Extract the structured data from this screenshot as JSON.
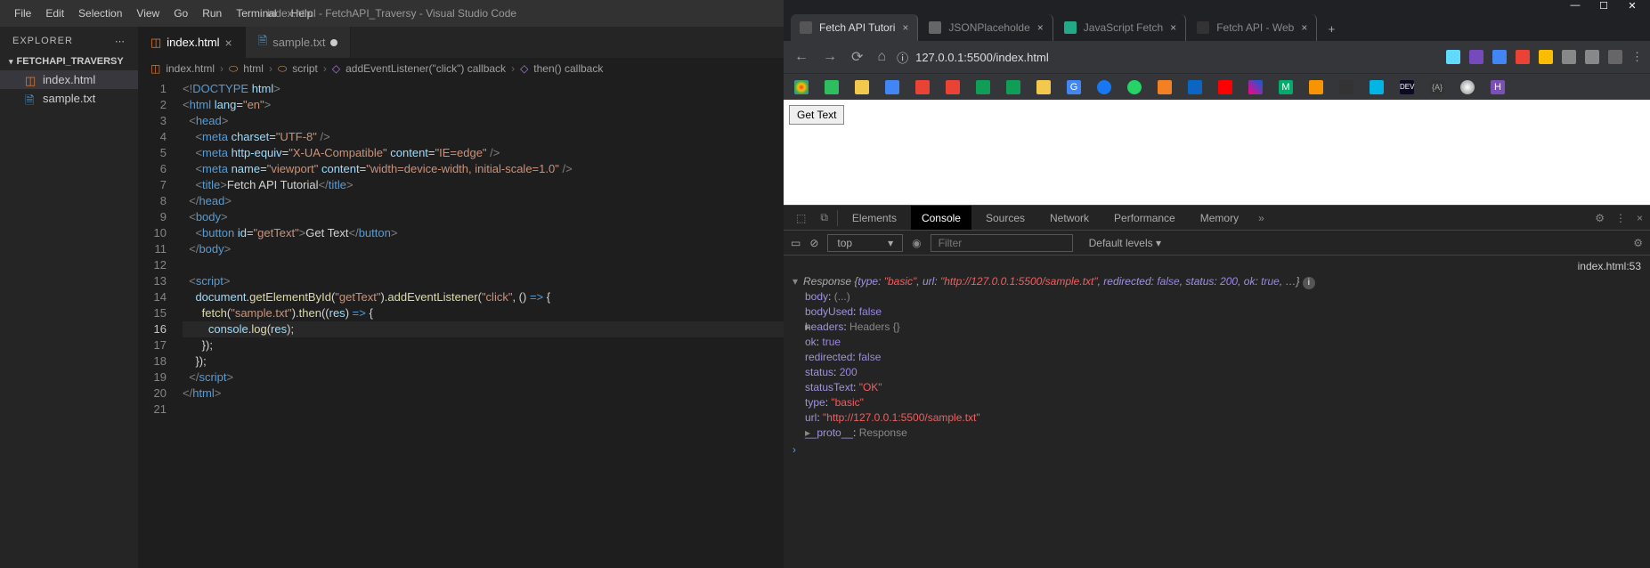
{
  "vscode": {
    "menubar": [
      "File",
      "Edit",
      "Selection",
      "View",
      "Go",
      "Run",
      "Terminal",
      "Help"
    ],
    "title": "index.html - FetchAPI_Traversy - Visual Studio Code",
    "explorer": {
      "header": "EXPLORER",
      "section": "FETCHAPI_TRAVERSY",
      "files": [
        "index.html",
        "sample.txt"
      ]
    },
    "tabs": [
      {
        "label": "index.html",
        "active": true,
        "dirty": false
      },
      {
        "label": "sample.txt",
        "active": false,
        "dirty": true
      }
    ],
    "breadcrumb": [
      "index.html",
      "html",
      "script",
      "addEventListener(\"click\") callback",
      "then() callback"
    ],
    "currentLine": 16,
    "code": {
      "lines": 21
    }
  },
  "browser": {
    "tabs": [
      {
        "label": "Fetch API Tutori",
        "active": true
      },
      {
        "label": "JSONPlaceholde",
        "active": false
      },
      {
        "label": "JavaScript Fetch",
        "active": false
      },
      {
        "label": "Fetch API - Web",
        "active": false
      }
    ],
    "url": "127.0.0.1:5500/index.html",
    "page_button": "Get Text"
  },
  "devtools": {
    "tabs": [
      "Elements",
      "Console",
      "Sources",
      "Network",
      "Performance",
      "Memory"
    ],
    "active_tab": "Console",
    "context": "top",
    "filter_placeholder": "Filter",
    "levels": "Default levels ▾",
    "source_link": "index.html:53",
    "response_summary": {
      "type": "basic",
      "url": "http://127.0.0.1:5500/sample.txt",
      "redirected": "false",
      "status": "status:",
      "status_val": "200",
      "ok": "true"
    },
    "props": [
      {
        "key": "body",
        "val": "(...)",
        "kind": "gray"
      },
      {
        "key": "bodyUsed",
        "val": "false",
        "kind": "bool"
      },
      {
        "key": "headers",
        "val": "Headers {}",
        "kind": "obj",
        "expand": true
      },
      {
        "key": "ok",
        "val": "true",
        "kind": "bool"
      },
      {
        "key": "redirected",
        "val": "false",
        "kind": "bool"
      },
      {
        "key": "status",
        "val": "200",
        "kind": "num"
      },
      {
        "key": "statusText",
        "val": "\"OK\"",
        "kind": "str"
      },
      {
        "key": "type",
        "val": "\"basic\"",
        "kind": "str"
      },
      {
        "key": "url",
        "val": "\"http://127.0.0.1:5500/sample.txt\"",
        "kind": "str"
      },
      {
        "key": "__proto__",
        "val": "Response",
        "kind": "gray",
        "expand": true
      }
    ]
  }
}
